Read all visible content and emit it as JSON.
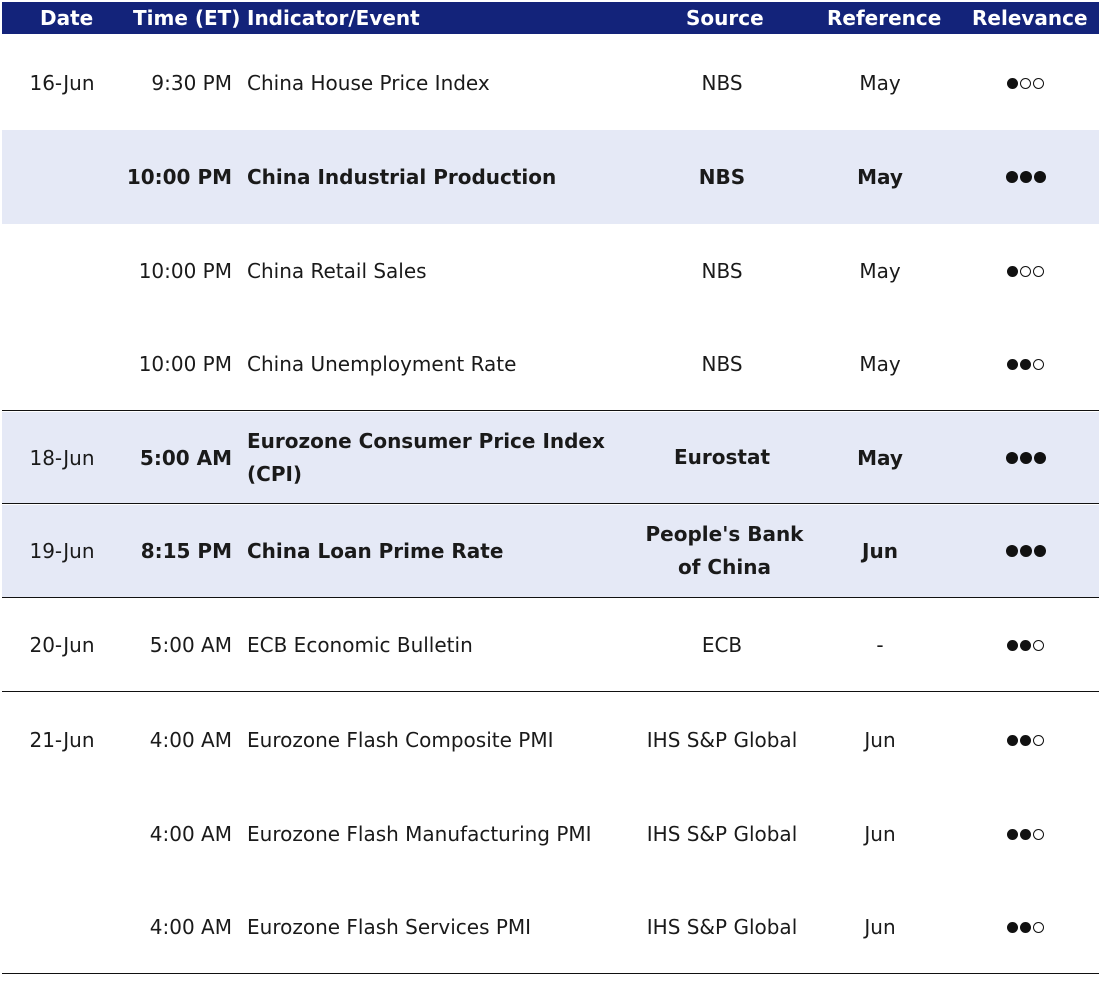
{
  "header": {
    "date": "Date",
    "time": "Time (ET)",
    "event": "Indicator/Event",
    "source": "Source",
    "reference": "Reference",
    "relevance": "Relevance"
  },
  "rows": [
    {
      "date": "16-Jun",
      "time": "9:30 PM",
      "event": "China House Price Index",
      "source": "NBS",
      "reference": "May",
      "relevance": 1
    },
    {
      "date": "",
      "time": "10:00 PM",
      "event": "China Industrial Production",
      "source": "NBS",
      "reference": "May",
      "relevance": 3
    },
    {
      "date": "",
      "time": "10:00 PM",
      "event": "China Retail Sales",
      "source": "NBS",
      "reference": "May",
      "relevance": 1
    },
    {
      "date": "",
      "time": "10:00 PM",
      "event": "China Unemployment Rate",
      "source": "NBS",
      "reference": "May",
      "relevance": 2
    },
    {
      "date": "18-Jun",
      "time": "5:00 AM",
      "event": "Eurozone Consumer Price Index (CPI)",
      "source": "Eurostat",
      "reference": "May",
      "relevance": 3
    },
    {
      "date": "19-Jun",
      "time": "8:15 PM",
      "event": "China Loan Prime Rate",
      "source": "People's Bank of China",
      "reference": "Jun",
      "relevance": 3
    },
    {
      "date": "20-Jun",
      "time": "5:00 AM",
      "event": "ECB Economic Bulletin",
      "source": "ECB",
      "reference": "-",
      "relevance": 2
    },
    {
      "date": "21-Jun",
      "time": "4:00 AM",
      "event": "Eurozone Flash Composite PMI",
      "source": "IHS S&P Global",
      "reference": "Jun",
      "relevance": 2
    },
    {
      "date": "",
      "time": "4:00 AM",
      "event": "Eurozone Flash Manufacturing PMI",
      "source": "IHS S&P Global",
      "reference": "Jun",
      "relevance": 2
    },
    {
      "date": "",
      "time": "4:00 AM",
      "event": "Eurozone Flash Services PMI",
      "source": "IHS S&P Global",
      "reference": "Jun",
      "relevance": 2
    }
  ],
  "colors": {
    "header_bg": "#13237a",
    "header_text": "#ffffff",
    "shaded_row": "#e5e9f6",
    "text": "#1a1a1a"
  }
}
